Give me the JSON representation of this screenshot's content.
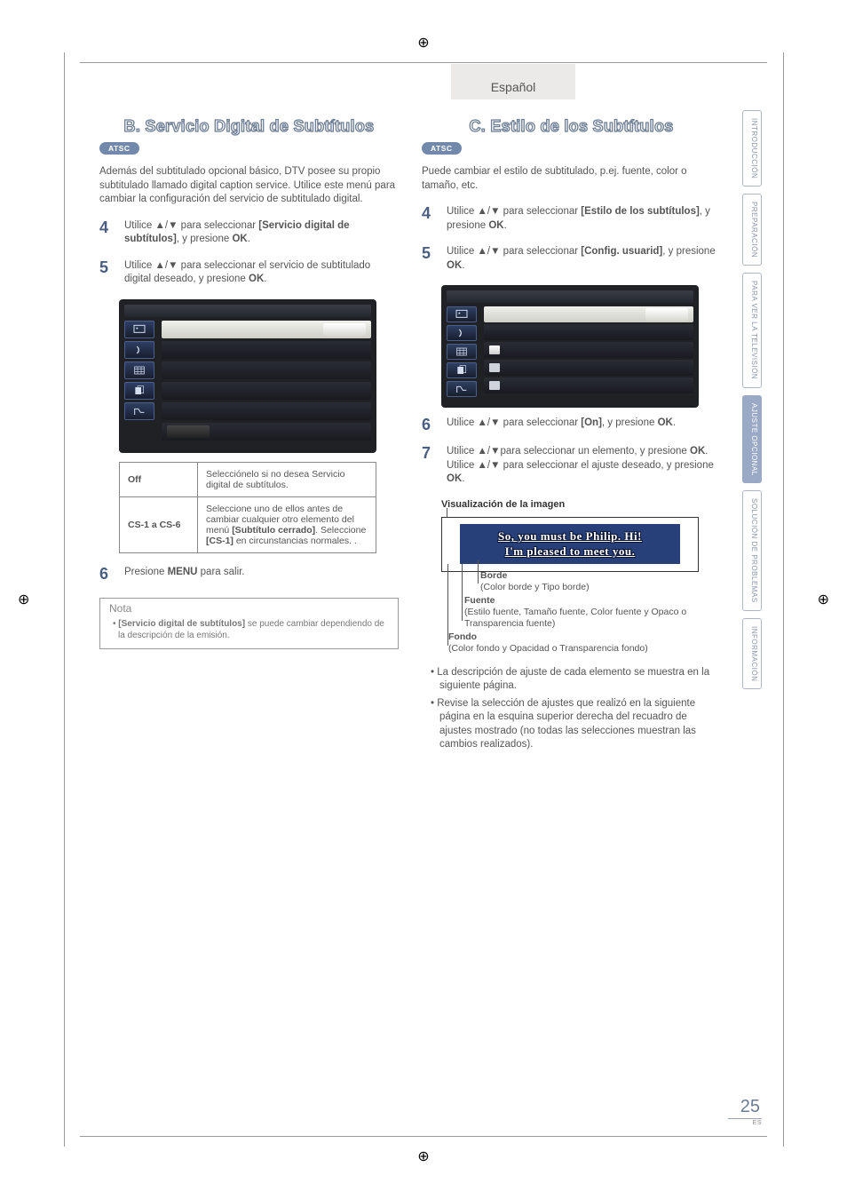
{
  "lang_tab": "Español",
  "page_number": "25",
  "page_lang_code": "ES",
  "side_tabs": [
    {
      "label": "INTRODUCCIÓN",
      "active": false
    },
    {
      "label": "PREPARACIÓN",
      "active": false
    },
    {
      "label": "PARA VER LA TELEVISIÓN",
      "active": false
    },
    {
      "label": "AJUSTE OPCIONAL",
      "active": true
    },
    {
      "label": "SOLUCIÓN DE PROBLEMAS",
      "active": false
    },
    {
      "label": "INFORMACIÓN",
      "active": false
    }
  ],
  "left": {
    "heading": "B.  Servicio Digital de Subtítulos",
    "pill": "ATSC",
    "intro": "Además del subtitulado opcional básico, DTV posee su propio subtitulado llamado digital caption service. Utilice este menú para cambiar la configuración del servicio de subtitulado digital.",
    "step4": {
      "num": "4",
      "pre": "Utilice ",
      "arrows": "▲/▼",
      "mid": " para seleccionar ",
      "bold": "[Servicio digital de subtítulos]",
      "post": ", y presione ",
      "ok": "OK",
      "end": "."
    },
    "step5": {
      "num": "5",
      "pre": "Utilice ",
      "arrows": "▲/▼",
      "post1": " para seleccionar el servicio de subtitulado digital deseado, y presione ",
      "ok": "OK",
      "end": "."
    },
    "table": {
      "row1": {
        "k": "Off",
        "v": "Selecciónelo si no desea Servicio digital de subtítulos."
      },
      "row2": {
        "k": "CS-1 a CS-6",
        "v": "Seleccione uno de ellos antes de cambiar cualquier otro elemento del menú [Subtítulo cerrado]. Seleccione [CS-1] en circunstancias normales. ."
      }
    },
    "step6": {
      "num": "6",
      "pre": "Presione ",
      "menu": "MENU",
      "post": " para salir."
    },
    "nota_title": "Nota",
    "nota_body": "[Servicio digital de subtítulos] se puede cambiar dependiendo de la descripción de la emisión."
  },
  "right": {
    "heading": "C.  Estilo de los Subtítulos",
    "pill": "ATSC",
    "intro": "Puede cambiar el estilo de subtitulado, p.ej. fuente, color o tamaño, etc.",
    "step4": {
      "num": "4",
      "pre": "Utilice ",
      "arrows": "▲/▼",
      "mid": " para seleccionar ",
      "bold": "[Estilo de los subtítulos]",
      "post": ", y presione ",
      "ok": "OK",
      "end": "."
    },
    "step5": {
      "num": "5",
      "pre": "Utilice ",
      "arrows": "▲/▼",
      "mid": " para seleccionar ",
      "bold": "[Config. usuarid]",
      "post": ", y presione ",
      "ok": "OK",
      "end": "."
    },
    "step6": {
      "num": "6",
      "pre": "Utilice ",
      "arrows": "▲/▼",
      "mid": " para seleccionar ",
      "bold": "[On]",
      "post": ", y presione ",
      "ok": "OK",
      "end": "."
    },
    "step7": {
      "num": "7",
      "pre": "Utilice ",
      "arrows": "▲/▼",
      "mid": "para seleccionar un elemento, y presione ",
      "ok1": "OK",
      "mid2": ". Utilice ",
      "arrows2": "▲/▼",
      "mid3": " para seleccionar el ajuste deseado, y presione ",
      "ok2": "OK",
      "end": "."
    },
    "viz_title": "Visualización de la imagen",
    "viz_l1": "So, you must be Philip. Hi!",
    "viz_l2": "I'm pleased to meet you.",
    "label_borde_t": "Borde",
    "label_borde_d": "(Color borde y Tipo borde)",
    "label_fuente_t": "Fuente",
    "label_fuente_d": "(Estilo fuente, Tamaño fuente, Color fuente y Opaco o Transparencia fuente)",
    "label_fondo_t": "Fondo",
    "label_fondo_d": "(Color fondo y Opacidad o Transparencia fondo)",
    "bullets": [
      "La descripción de ajuste de cada elemento se muestra en la siguiente página.",
      "Revise la selección de ajustes que realizó en la siguiente página en la esquina superior derecha del recuadro de ajustes mostrado (no todas las selecciones muestran las cambios realizados)."
    ]
  }
}
